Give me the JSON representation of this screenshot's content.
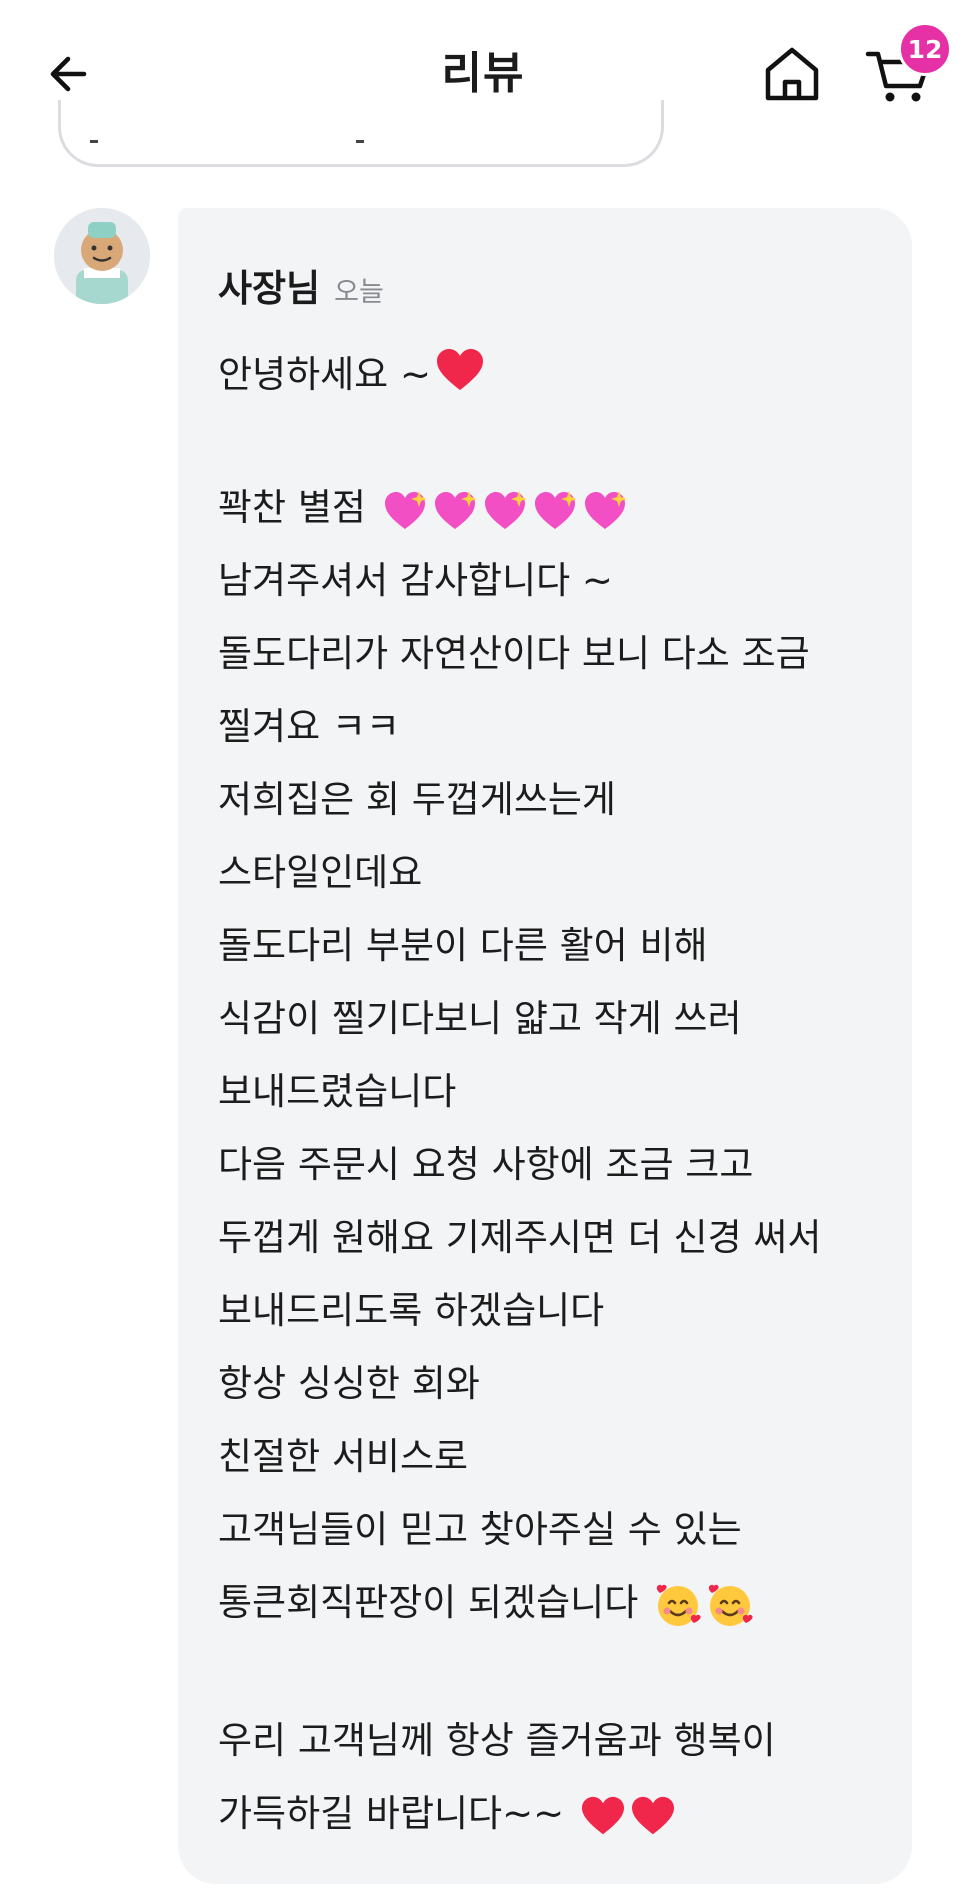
{
  "header": {
    "title": "리뷰",
    "cart_badge": "12"
  },
  "reply": {
    "author": "사장님",
    "time": "오늘",
    "lines": [
      "안녕하세요 ~",
      "꽉찬 별점",
      "남겨주셔서 감사합니다 ~",
      "돌도다리가 자연산이다 보니 다소 조금",
      "찔겨요 ㅋㅋ",
      "저희집은 회 두껍게쓰는게",
      "스타일인데요",
      "돌도다리 부분이 다른 활어 비해",
      "식감이 찔기다보니 얇고 작게 쓰러",
      "보내드렸습니다",
      "다음 주문시 요청 사항에 조금 크고",
      "두껍게 원해요 기제주시면 더 신경 써서",
      "보내드리도록 하겠습니다",
      "항상 싱싱한 회와",
      "친절한 서비스로",
      "고객님들이 믿고 찾아주실 수 있는",
      "통큰회직판장이 되겠습니다",
      "우리 고객님께 항상 즐거움과 행복이",
      "가득하길 바랍니다~~"
    ]
  },
  "colors": {
    "badge": "#e531a5",
    "bubble_bg": "#f3f4f6",
    "heart_red": "#f0264a",
    "heart_pink": "#f24fc4"
  },
  "icons": [
    "back-arrow-icon",
    "home-icon",
    "cart-icon",
    "red-heart-emoji",
    "sparkling-heart-emoji",
    "smiling-face-with-hearts-emoji"
  ]
}
